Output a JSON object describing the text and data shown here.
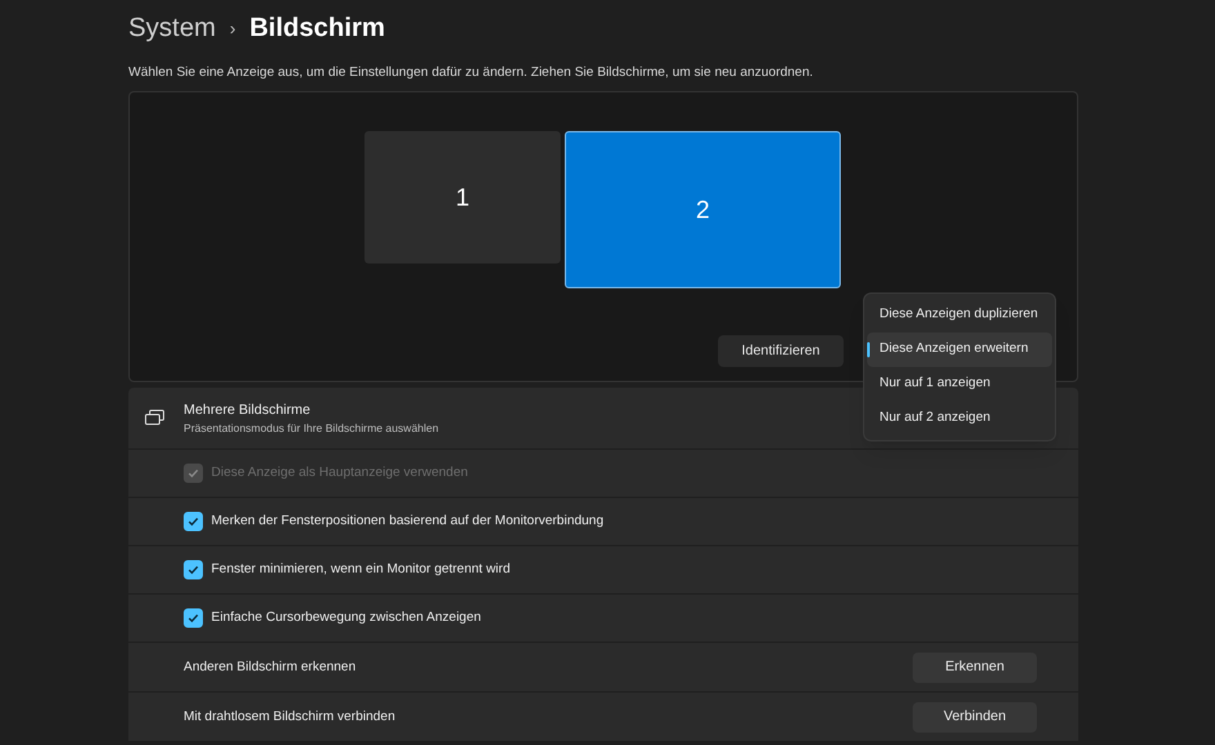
{
  "breadcrumb": {
    "parent": "System",
    "separator": "›",
    "current": "Bildschirm"
  },
  "description": "Wählen Sie eine Anzeige aus, um die Einstellungen dafür zu ändern. Ziehen Sie Bildschirme, um sie neu anzuordnen.",
  "monitors": [
    {
      "label": "1",
      "selected": false
    },
    {
      "label": "2",
      "selected": true
    }
  ],
  "identify_button": "Identifizieren",
  "mode_menu": [
    {
      "label": "Diese Anzeigen duplizieren",
      "selected": false
    },
    {
      "label": "Diese Anzeigen erweitern",
      "selected": true
    },
    {
      "label": "Nur auf 1 anzeigen",
      "selected": false
    },
    {
      "label": "Nur auf 2 anzeigen",
      "selected": false
    }
  ],
  "multiple_displays": {
    "title": "Mehrere Bildschirme",
    "subtitle": "Präsentationsmodus für Ihre Bildschirme auswählen"
  },
  "rows": [
    {
      "kind": "checkbox",
      "label": "Diese Anzeige als Hauptanzeige verwenden",
      "checked": true,
      "disabled": true
    },
    {
      "kind": "checkbox",
      "label": "Merken der Fensterpositionen basierend auf der Monitorverbindung",
      "checked": true,
      "disabled": false
    },
    {
      "kind": "checkbox",
      "label": "Fenster minimieren, wenn ein Monitor getrennt wird",
      "checked": true,
      "disabled": false
    },
    {
      "kind": "checkbox",
      "label": "Einfache Cursorbewegung zwischen Anzeigen",
      "checked": true,
      "disabled": false
    },
    {
      "kind": "button",
      "label": "Anderen Bildschirm erkennen",
      "button": "Erkennen"
    },
    {
      "kind": "button",
      "label": "Mit drahtlosem Bildschirm verbinden",
      "button": "Verbinden"
    }
  ]
}
